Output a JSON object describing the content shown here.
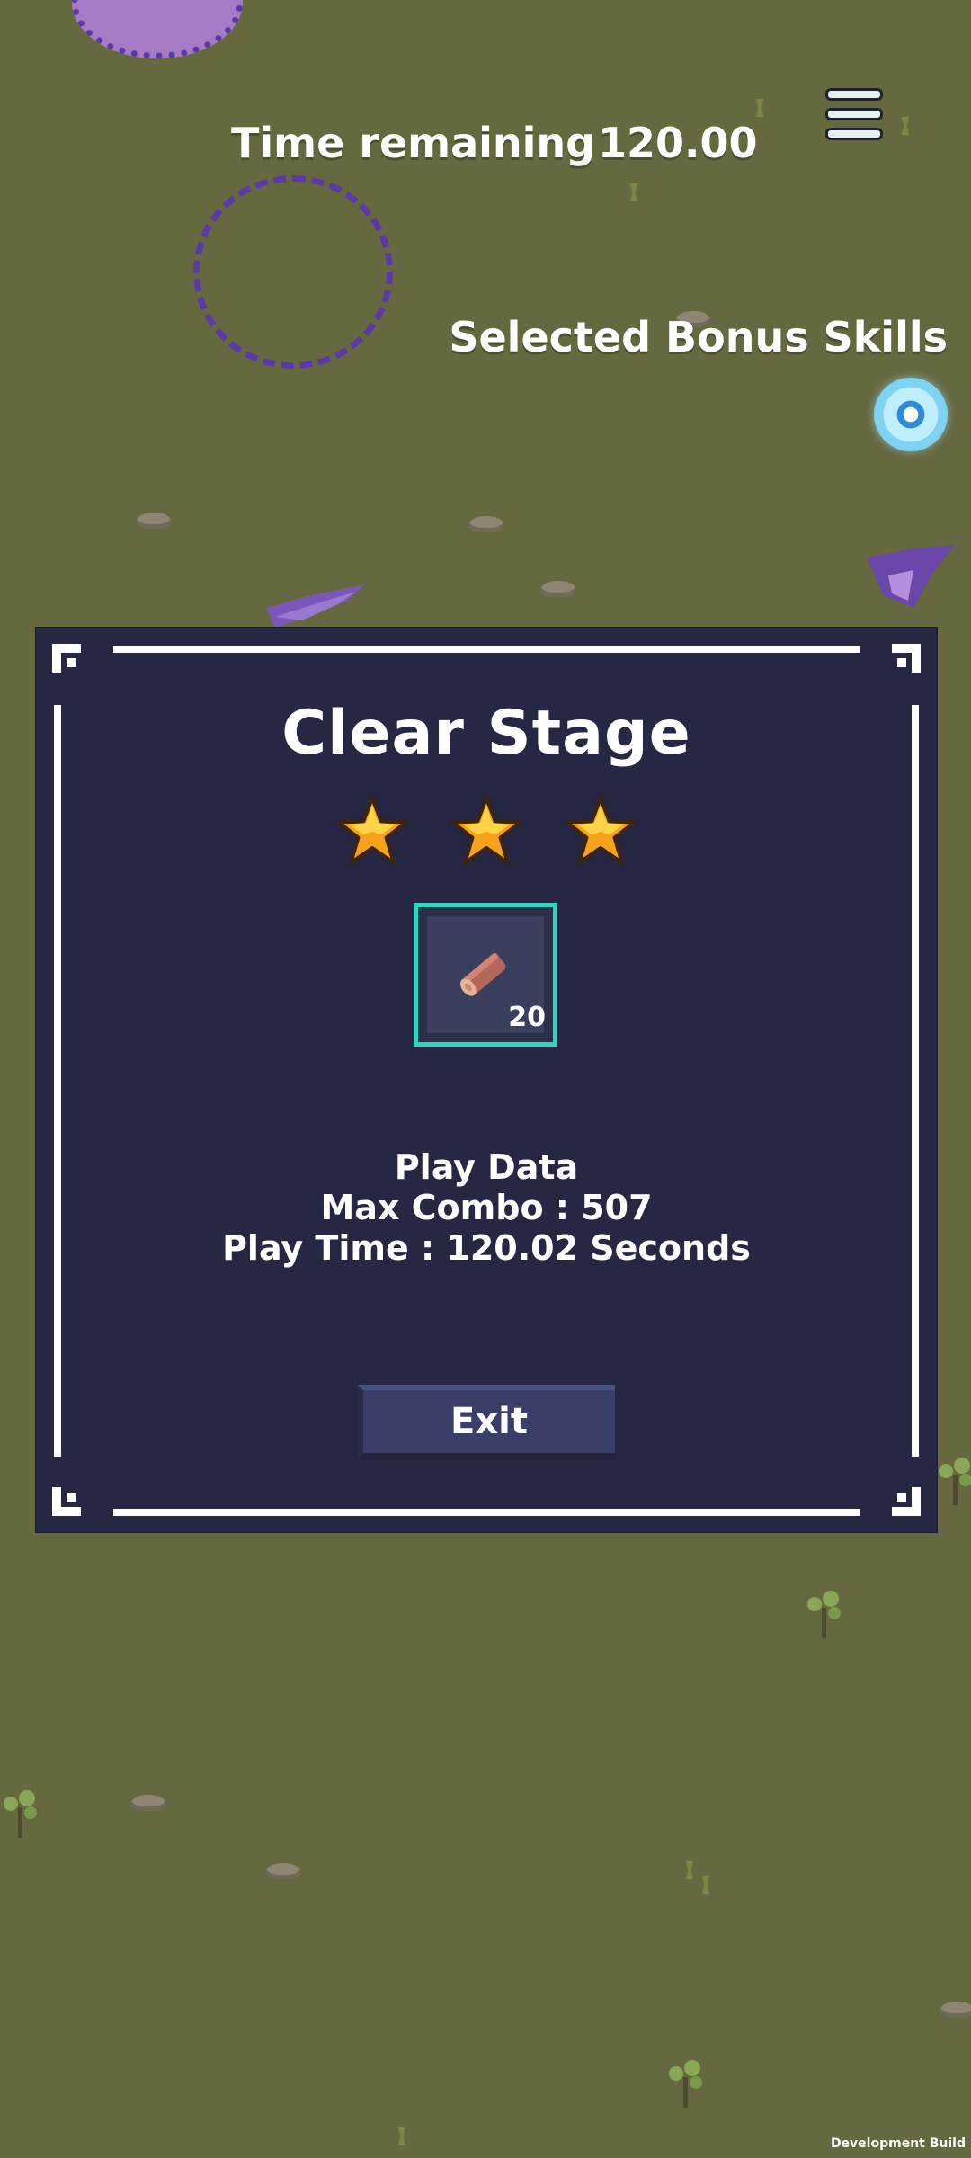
{
  "hud": {
    "time_label": "Time remaining",
    "time_value": "120.00",
    "bonus_label": "Selected Bonus Skills",
    "menu_icon": "hamburger-menu-icon",
    "bonus_skill_icon": "eye-orb-icon"
  },
  "dialog": {
    "title": "Clear Stage",
    "stars_earned": 3,
    "stars_total": 3,
    "reward": {
      "icon": "wood-log-icon",
      "count": "20"
    },
    "stats": {
      "heading": "Play Data",
      "max_combo": "Max Combo : 507",
      "play_time": "Play Time : 120.02 Seconds"
    },
    "exit_label": "Exit"
  },
  "footer": {
    "build_label": "Development Build"
  },
  "colors": {
    "ground": "#66683f",
    "dialog_bg": "#262843",
    "reward_border": "#30d4bf",
    "button": "#3a3f69",
    "star": "#f6a21a"
  }
}
